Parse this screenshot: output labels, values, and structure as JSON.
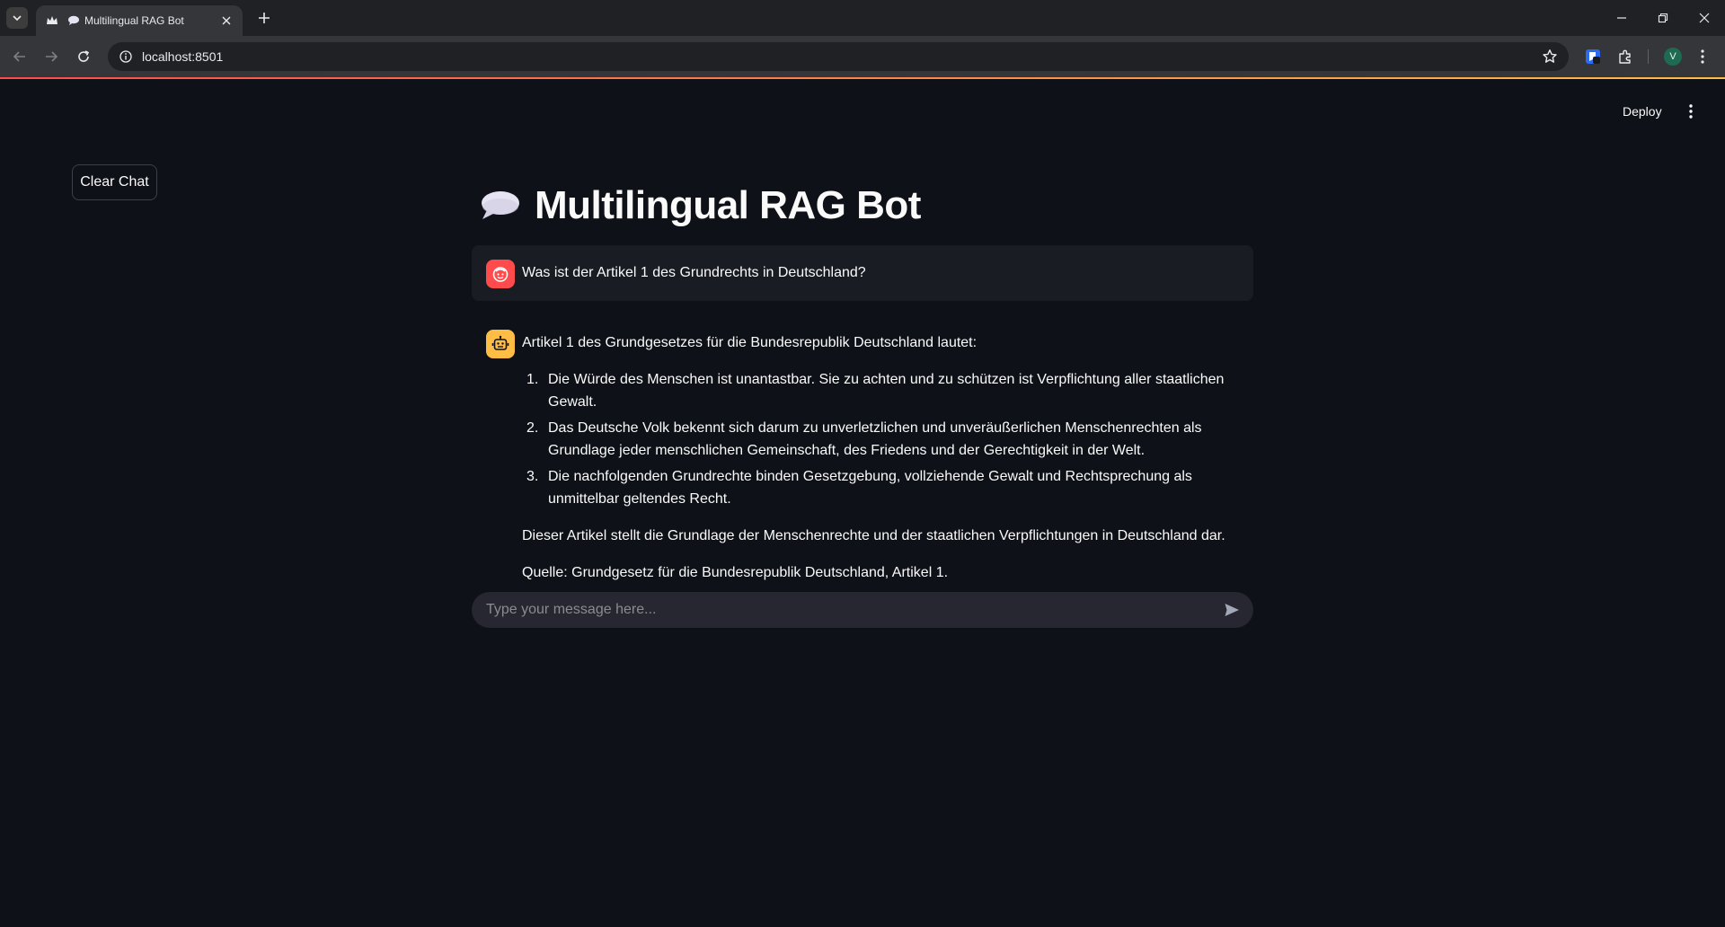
{
  "browser": {
    "tab": {
      "title": "Multilingual RAG Bot"
    },
    "url": "localhost:8501",
    "profile_initial": "V"
  },
  "app": {
    "header": {
      "deploy_label": "Deploy"
    },
    "sidebar": {
      "clear_chat_label": "Clear Chat"
    },
    "title": "Multilingual RAG Bot",
    "title_icon": "speech-balloon-icon",
    "messages": [
      {
        "role": "user",
        "avatar_icon": "face-icon",
        "text": "Was ist der Artikel 1 des Grundrechts in Deutschland?"
      },
      {
        "role": "assistant",
        "avatar_icon": "robot-icon",
        "intro": "Artikel 1 des Grundgesetzes für die Bundesrepublik Deutschland lautet:",
        "list": [
          {
            "num": "1.",
            "text": "Die Würde des Menschen ist unantastbar. Sie zu achten und zu schützen ist Verpflichtung aller staatlichen Gewalt."
          },
          {
            "num": "2.",
            "text": "Das Deutsche Volk bekennt sich darum zu unverletzlichen und unveräußerlichen Menschenrechten als Grundlage jeder menschlichen Gemeinschaft, des Friedens und der Gerechtigkeit in der Welt."
          },
          {
            "num": "3.",
            "text": "Die nachfolgenden Grundrechte binden Gesetzgebung, vollziehende Gewalt und Rechtsprechung als unmittelbar geltendes Recht."
          }
        ],
        "summary": "Dieser Artikel stellt die Grundlage der Menschenrechte und der staatlichen Verpflichtungen in Deutschland dar.",
        "source": "Quelle: Grundgesetz für die Bundesrepublik Deutschland, Artikel 1."
      }
    ],
    "chat_input": {
      "placeholder": "Type your message here...",
      "value": ""
    }
  },
  "colors": {
    "background": "#0e1117",
    "user_avatar": "#ff4b4b",
    "bot_avatar": "#ffbd45",
    "input_bg": "#262730"
  }
}
